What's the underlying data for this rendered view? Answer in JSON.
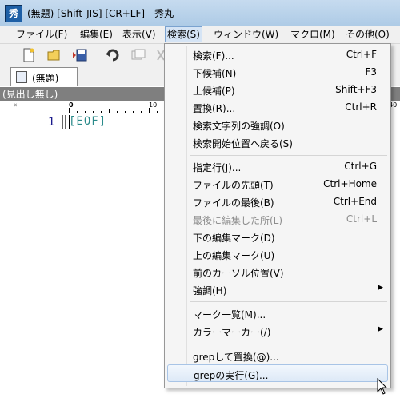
{
  "window": {
    "title": "(無題) [Shift-JIS] [CR+LF] - 秀丸",
    "app_icon_glyph": "秀"
  },
  "menubar": {
    "items": [
      {
        "label": "ファイル(F)"
      },
      {
        "label": "編集(E)"
      },
      {
        "label": "表示(V)"
      },
      {
        "label": "検索(S)"
      },
      {
        "label": "ウィンドウ(W)"
      },
      {
        "label": "マクロ(M)"
      },
      {
        "label": "その他(O)"
      }
    ]
  },
  "tabs": [
    {
      "label": "(無題)"
    }
  ],
  "heading_bar": {
    "label": "(見出し無し)"
  },
  "ruler": {
    "marks": [
      "0",
      "10",
      "40"
    ],
    "chevron": "«"
  },
  "editor": {
    "line_number": "1",
    "eof_marker": "[EOF]"
  },
  "search_menu": {
    "items": [
      {
        "label": "検索(F)...",
        "shortcut": "Ctrl+F"
      },
      {
        "label": "下候補(N)",
        "shortcut": "F3"
      },
      {
        "label": "上候補(P)",
        "shortcut": "Shift+F3"
      },
      {
        "label": "置換(R)...",
        "shortcut": "Ctrl+R"
      },
      {
        "label": "検索文字列の強調(O)",
        "shortcut": ""
      },
      {
        "label": "検索開始位置へ戻る(S)",
        "shortcut": ""
      },
      {
        "label": "指定行(J)...",
        "shortcut": "Ctrl+G"
      },
      {
        "label": "ファイルの先頭(T)",
        "shortcut": "Ctrl+Home"
      },
      {
        "label": "ファイルの最後(B)",
        "shortcut": "Ctrl+End"
      },
      {
        "label": "最後に編集した所(L)",
        "shortcut": "Ctrl+L",
        "disabled": true
      },
      {
        "label": "下の編集マーク(D)",
        "shortcut": ""
      },
      {
        "label": "上の編集マーク(U)",
        "shortcut": ""
      },
      {
        "label": "前のカーソル位置(V)",
        "shortcut": ""
      },
      {
        "label": "強調(H)",
        "shortcut": "",
        "submenu": true
      },
      {
        "label": "マーク一覧(M)...",
        "shortcut": ""
      },
      {
        "label": "カラーマーカー(/)",
        "shortcut": "",
        "submenu": true
      },
      {
        "label": "grepして置換(@)...",
        "shortcut": ""
      },
      {
        "label": "grepの実行(G)...",
        "shortcut": "",
        "highlighted": true
      }
    ]
  },
  "colors": {
    "menu_open_bg": "#d5e4f5",
    "heading_bar_bg": "#7f7f7f",
    "eof_color": "#2a8a8a"
  }
}
